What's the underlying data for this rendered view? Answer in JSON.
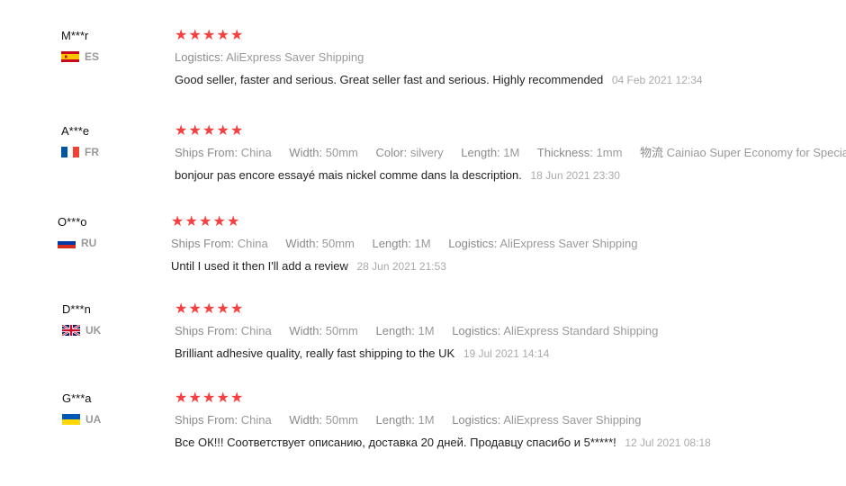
{
  "reviews": [
    {
      "user": "M***r",
      "country": "ES",
      "flag": "spain-flag-icon",
      "stars": 5,
      "attrs": [
        {
          "key": "Logistics:",
          "value": "AliExpress Saver Shipping"
        }
      ],
      "text": "Good seller, faster and serious. Great seller fast and serious. Highly recommended",
      "date": "04 Feb 2021 12:34"
    },
    {
      "user": "A***e",
      "country": "FR",
      "flag": "france-flag-icon",
      "stars": 5,
      "attrs": [
        {
          "key": "Ships From:",
          "value": "China"
        },
        {
          "key": "Width:",
          "value": "50mm"
        },
        {
          "key": "Color:",
          "value": "silvery"
        },
        {
          "key": "Length:",
          "value": "1M"
        },
        {
          "key": "Thickness:",
          "value": "1mm"
        },
        {
          "key": "物流",
          "value": "Cainiao Super Economy for Special Goods"
        }
      ],
      "text": "bonjour pas encore essayé mais nickel comme dans la description.",
      "date": "18 Jun 2021 23:30"
    },
    {
      "user": "O***o",
      "country": "RU",
      "flag": "russia-flag-icon",
      "stars": 5,
      "attrs": [
        {
          "key": "Ships From:",
          "value": "China"
        },
        {
          "key": "Width:",
          "value": "50mm"
        },
        {
          "key": "Length:",
          "value": "1M"
        },
        {
          "key": "Logistics:",
          "value": "AliExpress Saver Shipping"
        }
      ],
      "text": "Until I used it then I'll add a review",
      "date": "28 Jun 2021 21:53"
    },
    {
      "user": "D***n",
      "country": "UK",
      "flag": "uk-flag-icon",
      "stars": 5,
      "attrs": [
        {
          "key": "Ships From:",
          "value": "China"
        },
        {
          "key": "Width:",
          "value": "50mm"
        },
        {
          "key": "Length:",
          "value": "1M"
        },
        {
          "key": "Logistics:",
          "value": "AliExpress Standard Shipping"
        }
      ],
      "text": "Brilliant adhesive quality, really fast shipping to the UK",
      "date": "19 Jul 2021 14:14"
    },
    {
      "user": "G***a",
      "country": "UA",
      "flag": "ukraine-flag-icon",
      "stars": 5,
      "attrs": [
        {
          "key": "Ships From:",
          "value": "China"
        },
        {
          "key": "Width:",
          "value": "50mm"
        },
        {
          "key": "Length:",
          "value": "1M"
        },
        {
          "key": "Logistics:",
          "value": "AliExpress Saver Shipping"
        }
      ],
      "text": "Все ОК!!! Соответствует описанию, доставка 20 дней. Продавцу спасибо и 5*****!",
      "date": "12 Jul 2021 08:18"
    }
  ],
  "colors": {
    "star": "#f5403f",
    "muted": "#999999",
    "text": "#222222",
    "date": "#aaaaaa"
  }
}
